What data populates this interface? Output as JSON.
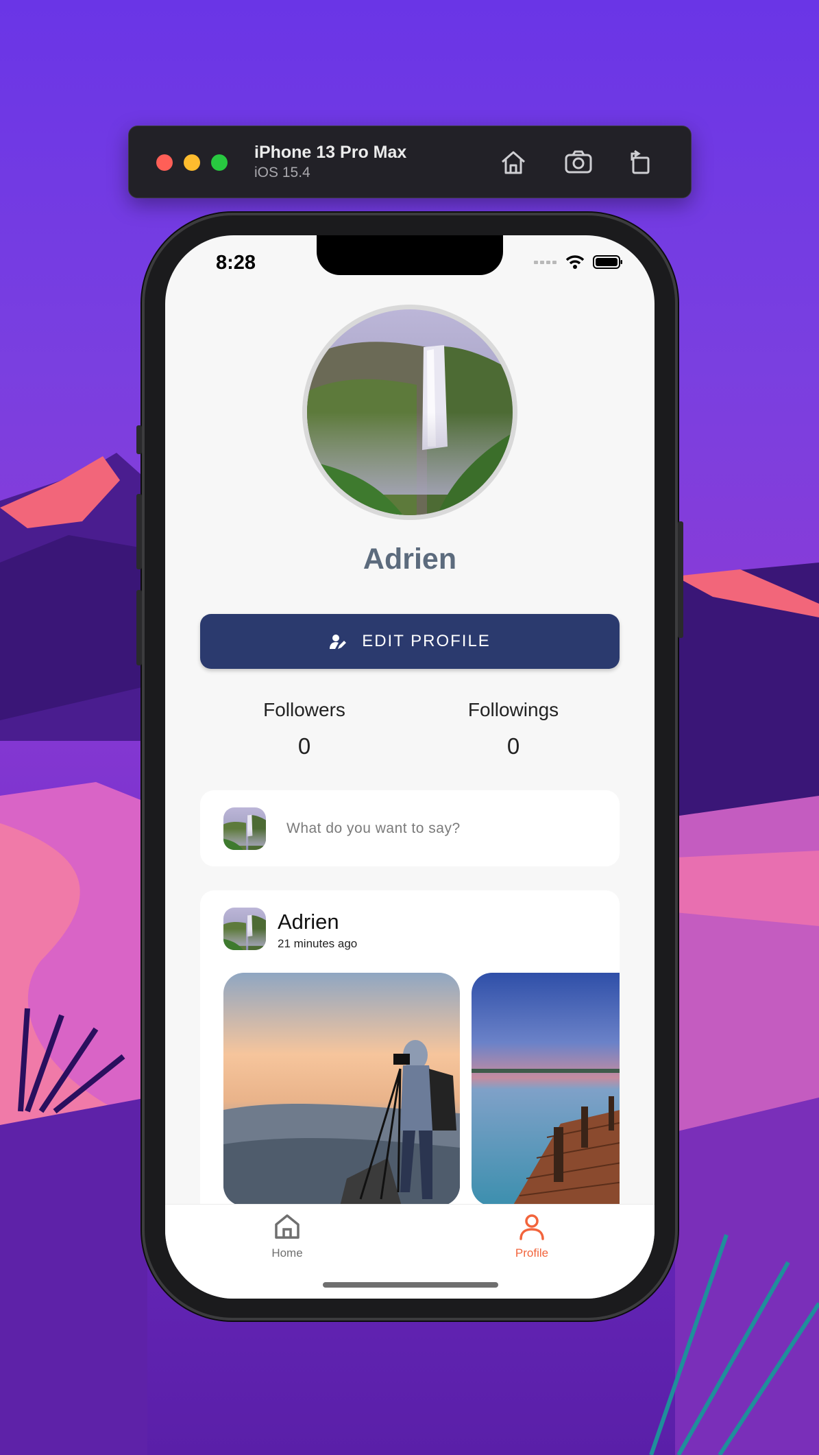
{
  "simulator": {
    "device_name": "iPhone 13 Pro Max",
    "os_version": "iOS 15.4",
    "buttons": [
      "home-icon",
      "screenshot-icon",
      "rotate-icon"
    ],
    "traffic_lights": [
      "#ff5f57",
      "#febc2e",
      "#28c840"
    ]
  },
  "status_bar": {
    "time": "8:28",
    "icons": [
      "signal-icon",
      "wifi-icon",
      "battery-icon"
    ]
  },
  "profile": {
    "name": "Adrien",
    "edit_button_label": "EDIT PROFILE",
    "stats": [
      {
        "label": "Followers",
        "value": "0"
      },
      {
        "label": "Followings",
        "value": "0"
      }
    ]
  },
  "composer": {
    "placeholder": "What do you want to say?"
  },
  "post": {
    "author": "Adrien",
    "time_ago": "21 minutes ago",
    "images": [
      "photographer-sunset-image",
      "lake-pier-image"
    ]
  },
  "tab_bar": {
    "tabs": [
      {
        "label": "Home",
        "icon": "home-icon",
        "active": false
      },
      {
        "label": "Profile",
        "icon": "person-icon",
        "active": true
      }
    ],
    "active_color": "#f2643c",
    "inactive_color": "#6f6f6f"
  },
  "colors": {
    "primary_button": "#2b3a6e",
    "name_text": "#5c6b7d"
  }
}
